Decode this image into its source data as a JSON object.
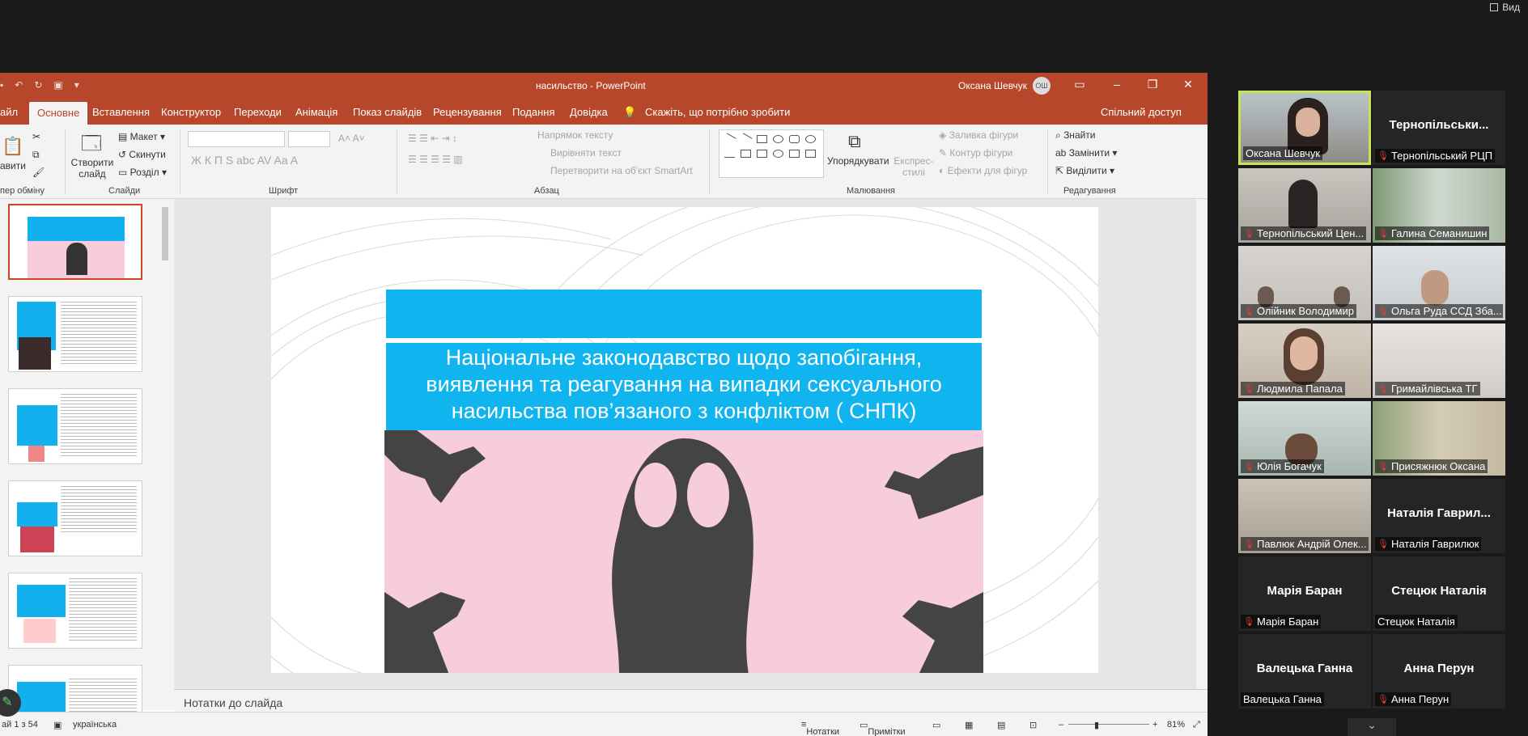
{
  "zoom": {
    "view_label": "Вид"
  },
  "ppt": {
    "window_title": "насильство  -  PowerPoint",
    "user": "Оксана Шевчук",
    "user_initials": "ОШ",
    "tabs": [
      "айл",
      "Основне",
      "Вставлення",
      "Конструктор",
      "Переходи",
      "Анімація",
      "Показ слайдів",
      "Рецензування",
      "Подання",
      "Довідка"
    ],
    "tell_me": "Скажіть, що потрібно зробити",
    "share": "Спільний доступ",
    "ribbon": {
      "paste": "авити",
      "new_slide": "Створити слайд",
      "layout": "Макет",
      "reset": "Скинути",
      "section": "Розділ",
      "text_direction": "Напрямок тексту",
      "align_text": "Вирівняти текст",
      "smartart": "Перетворити на об'єкт SmartArt",
      "arrange": "Упорядкувати",
      "quick_styles": "Експрес-стилі",
      "shape_fill": "Заливка фігури",
      "shape_outline": "Контур фігури",
      "shape_effects": "Ефекти для фігур",
      "find": "Знайти",
      "replace": "Замінити",
      "select": "Виділити",
      "groups": {
        "clipboard": "пер обміну",
        "slides": "Слайди",
        "font": "Шрифт",
        "paragraph": "Абзац",
        "drawing": "Малювання",
        "editing": "Редагування"
      }
    },
    "slide": {
      "title_lines": [
        "Національне законодавство щодо запобігання,",
        "виявлення та реагування на випадки сексуального",
        "насильства пов’язаного з конфліктом ( СНПК)"
      ]
    },
    "notes_placeholder": "Нотатки до слайда",
    "status": {
      "slide_count": "ай 1 з 54",
      "language": "українська",
      "notes": "Нотатки",
      "comments": "Примітки",
      "zoom": "81%"
    }
  },
  "participants": [
    {
      "name": "Оксана Шевчук",
      "muted": false,
      "video": true,
      "speaking": true
    },
    {
      "name": "Тернопільський РЦП",
      "big": "Тернопільськи...",
      "muted": true,
      "video": false
    },
    {
      "name": "Тернопільський Цен...",
      "muted": true,
      "video": true
    },
    {
      "name": "Галина Семанишин",
      "muted": true,
      "video": true
    },
    {
      "name": "Олійник Володимир",
      "muted": true,
      "video": true
    },
    {
      "name": "Ольга Руда ССД Зба...",
      "muted": true,
      "video": true
    },
    {
      "name": "Людмила Папала",
      "muted": true,
      "video": true
    },
    {
      "name": "Гримайлівська ТГ",
      "muted": true,
      "video": true
    },
    {
      "name": "Юлія Богачук",
      "muted": true,
      "video": true
    },
    {
      "name": "Присяжнюк Оксана",
      "muted": true,
      "video": true
    },
    {
      "name": "Павлюк Андрій Олек...",
      "muted": true,
      "video": true
    },
    {
      "name": "Наталія Гаврилюк",
      "big": "Наталія Гаврил...",
      "muted": true,
      "video": false
    },
    {
      "name": "Марія Баран",
      "big": "Марія Баран",
      "muted": true,
      "video": false
    },
    {
      "name": "Стецюк Наталія",
      "big": "Стецюк Наталія",
      "muted": false,
      "video": false
    },
    {
      "name": "Валецька Ганна",
      "big": "Валецька Ганна",
      "muted": false,
      "video": false
    },
    {
      "name": "Анна Перун",
      "big": "Анна Перун",
      "muted": true,
      "video": false
    }
  ],
  "colors": {
    "ppt_accent": "#b7472a",
    "slide_blue": "#10b4ef",
    "slide_pink": "#f7cddd",
    "speaker_border": "#c7e254"
  }
}
